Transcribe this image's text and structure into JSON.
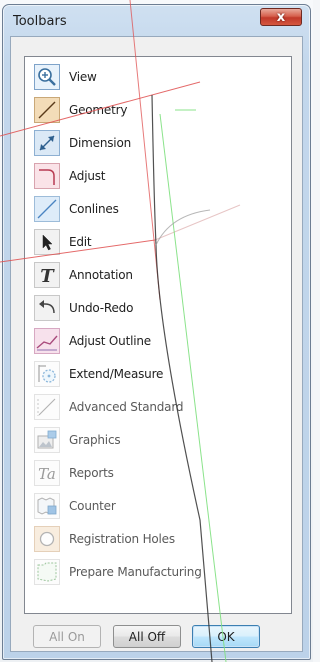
{
  "window": {
    "title": "Toolbars",
    "close_symbol": "x"
  },
  "toolbars": [
    {
      "label": "View",
      "icon": "magnifier-icon"
    },
    {
      "label": "Geometry",
      "icon": "geometry-line-icon"
    },
    {
      "label": "Dimension",
      "icon": "dimension-arrows-icon"
    },
    {
      "label": "Adjust",
      "icon": "adjust-corner-icon"
    },
    {
      "label": "Conlines",
      "icon": "conline-icon"
    },
    {
      "label": "Edit",
      "icon": "cursor-arrow-icon"
    },
    {
      "label": "Annotation",
      "icon": "text-t-icon",
      "glyph": "T"
    },
    {
      "label": "Undo-Redo",
      "icon": "undo-arrow-icon"
    },
    {
      "label": "Adjust Outline",
      "icon": "adjust-outline-icon"
    },
    {
      "label": "Extend/Measure",
      "icon": "extend-measure-icon"
    },
    {
      "label": "Advanced Standard",
      "icon": "advanced-standard-icon"
    },
    {
      "label": "Graphics",
      "icon": "graphics-icon"
    },
    {
      "label": "Reports",
      "icon": "reports-ta-icon",
      "glyph": "Ta"
    },
    {
      "label": "Counter",
      "icon": "counter-icon"
    },
    {
      "label": "Registration Holes",
      "icon": "registration-hole-icon"
    },
    {
      "label": "Prepare Manufacturing",
      "icon": "prepare-manufacturing-icon"
    }
  ],
  "buttons": {
    "all_on": "All On",
    "all_off": "All Off",
    "ok": "OK"
  },
  "colors": {
    "close_red": "#c1392a",
    "ok_border": "#3c7fb1",
    "cad_red": "#e05050",
    "cad_green": "#7fe07f"
  }
}
